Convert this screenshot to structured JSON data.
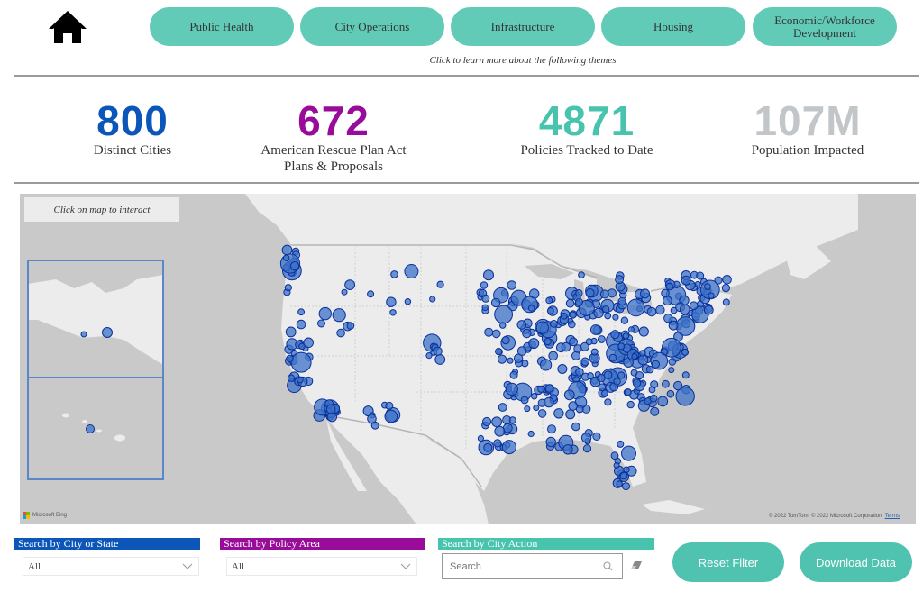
{
  "nav": {
    "home_icon": "home-icon",
    "themes": [
      "Public Health",
      "City Operations",
      "Infrastructure",
      "Housing",
      "Economic/Workforce Development"
    ],
    "themes_hint": "Click to learn more about the following themes"
  },
  "kpis": [
    {
      "value": "800",
      "label": "Distinct Cities",
      "color": "#0b56b8"
    },
    {
      "value": "672",
      "label_line1": "American Rescue Plan Act",
      "label_line2": "Plans & Proposals",
      "color": "#980c99"
    },
    {
      "value": "4871",
      "label": "Policies Tracked to Date",
      "color": "#48c4ae"
    },
    {
      "value": "107M",
      "label": "Population Impacted",
      "color": "#c2c6c9"
    }
  ],
  "map": {
    "hint": "Click on map to interact",
    "provider": "Microsoft Bing",
    "copyright": "© 2022 TomTom, © 2022 Microsoft Corporation",
    "terms_link": "Terms",
    "marker_color": "#3e73c8",
    "marker_stroke": "#0a2f9a"
  },
  "filters": {
    "city_state": {
      "title": "Search by City or State",
      "value": "All",
      "color": "#0b56b8"
    },
    "policy_area": {
      "title": "Search by Policy Area",
      "value": "All",
      "color": "#980c99"
    },
    "city_action": {
      "title": "Search by City Action",
      "placeholder": "Search",
      "color": "#48c4ae"
    }
  },
  "buttons": {
    "reset": "Reset Filter",
    "download": "Download Data"
  }
}
